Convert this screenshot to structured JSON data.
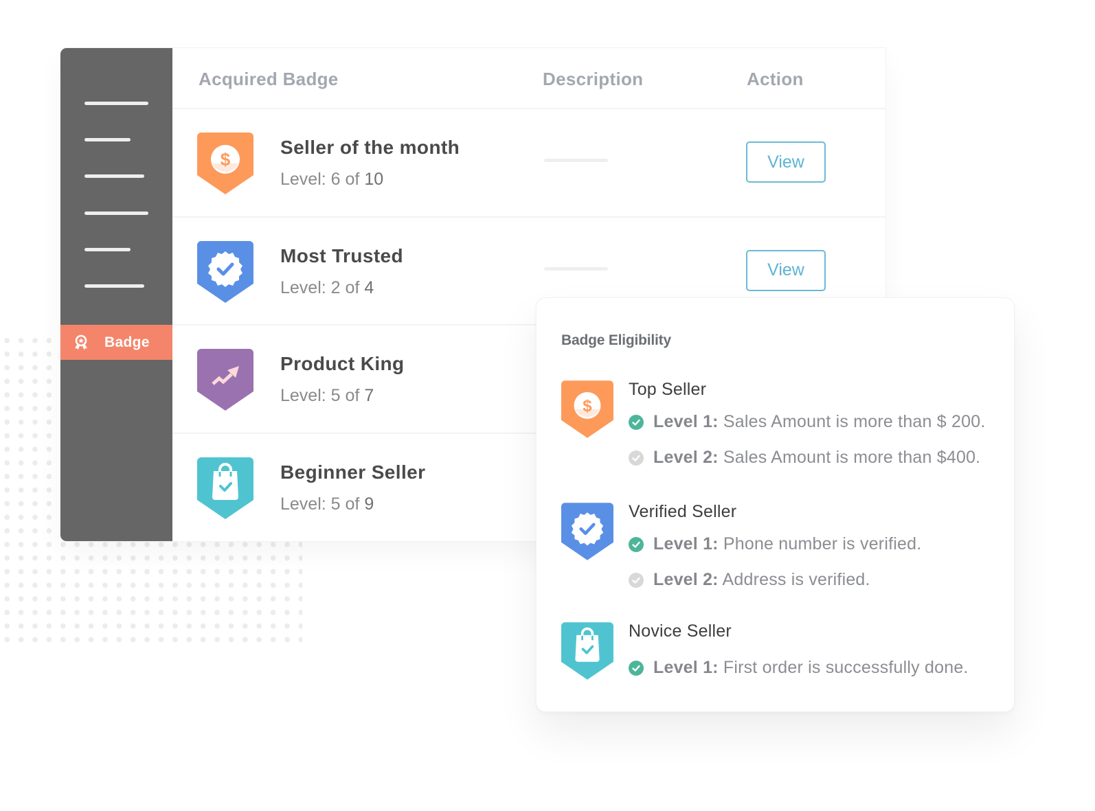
{
  "sidebar": {
    "active_item": {
      "label": "Badge",
      "icon": "ribbon-badge-icon",
      "color": "#f4856a"
    },
    "placeholder_menu_lines": 6,
    "background": "#666666"
  },
  "table": {
    "headers": {
      "badge": "Acquired Badge",
      "description": "Description",
      "action": "Action"
    },
    "rows": [
      {
        "title": "Seller of the month",
        "level_prefix": "Level: 6 of",
        "level_max": "10",
        "icon": "dollar-icon",
        "color": "#fd9a5a",
        "action": "View"
      },
      {
        "title": "Most Trusted",
        "level_prefix": "Level: 2 of",
        "level_max": "4",
        "icon": "verified-check-icon",
        "color": "#5a8fe6",
        "action": "View"
      },
      {
        "title": "Product King",
        "level_prefix": "Level: 5 of",
        "level_max": "7",
        "icon": "trending-up-icon",
        "color": "#9a72b0",
        "action": ""
      },
      {
        "title": "Beginner Seller",
        "level_prefix": "Level: 5 of",
        "level_max": "9",
        "icon": "shopping-bag-check-icon",
        "color": "#4fc4d0",
        "action": ""
      }
    ]
  },
  "popup": {
    "title": "Badge Eligibility",
    "groups": [
      {
        "name": "Top Seller",
        "icon": "dollar-icon",
        "color": "#fd9a5a",
        "criteria": [
          {
            "level": "Level 1:",
            "text": "Sales Amount is more than $ 200.",
            "done": true
          },
          {
            "level": "Level 2:",
            "text": "Sales Amount is more than $400.",
            "done": false
          }
        ]
      },
      {
        "name": "Verified Seller",
        "icon": "verified-check-icon",
        "color": "#5a8fe6",
        "criteria": [
          {
            "level": "Level 1:",
            "text": "Phone number is verified.",
            "done": true
          },
          {
            "level": "Level 2:",
            "text": "Address is verified.",
            "done": false
          }
        ]
      },
      {
        "name": "Novice Seller",
        "icon": "shopping-bag-check-icon",
        "color": "#4fc4d0",
        "criteria": [
          {
            "level": "Level 1:",
            "text": "First order is successfully done.",
            "done": true
          }
        ]
      }
    ]
  },
  "colors": {
    "check_done": "#4db59a",
    "check_pending": "#d8d8d8",
    "view_button": "#5eb3d6"
  }
}
